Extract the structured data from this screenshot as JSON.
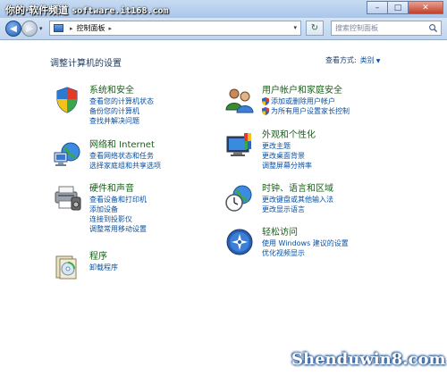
{
  "watermark_top": {
    "chinese": "你的·软件频道",
    "url": "software.it168.com"
  },
  "window_buttons": {
    "minimize": "–",
    "maximize": "□",
    "close": "✕"
  },
  "address": {
    "breadcrumb_sep": "▸",
    "path": "控制面板",
    "path_sep": "▸",
    "dropdown": "▾"
  },
  "nav": {
    "back": "◀",
    "forward": "▶",
    "recent": "▾",
    "refresh": "↻"
  },
  "search": {
    "placeholder": "搜索控制面板"
  },
  "main": {
    "title": "调整计算机的设置",
    "view_by_label": "查看方式:",
    "view_by_value": "类别",
    "view_by_caret": "▼"
  },
  "categories_left": [
    {
      "icon": "system-security-icon",
      "title": "系统和安全",
      "links": [
        "查看您的计算机状态",
        "备份您的计算机",
        "查找并解决问题"
      ]
    },
    {
      "icon": "network-internet-icon",
      "title": "网络和 Internet",
      "links": [
        "查看网络状态和任务",
        "选择家庭组和共享选项"
      ]
    },
    {
      "icon": "hardware-sound-icon",
      "title": "硬件和声音",
      "links": [
        "查看设备和打印机",
        "添加设备",
        "连接到投影仪",
        "调整常用移动设置"
      ]
    },
    {
      "icon": "programs-icon",
      "title": "程序",
      "links": [
        "卸载程序"
      ]
    }
  ],
  "categories_right": [
    {
      "icon": "user-accounts-icon",
      "title": "用户帐户和家庭安全",
      "links": [
        "添加或删除用户帐户",
        "为所有用户设置家长控制"
      ]
    },
    {
      "icon": "appearance-icon",
      "title": "外观和个性化",
      "links": [
        "更改主题",
        "更改桌面背景",
        "调整屏幕分辨率"
      ]
    },
    {
      "icon": "clock-language-icon",
      "title": "时钟、语言和区域",
      "links": [
        "更改键盘或其他输入法",
        "更改显示语言"
      ]
    },
    {
      "icon": "ease-of-access-icon",
      "title": "轻松访问",
      "links": [
        "使用 Windows 建议的设置",
        "优化视频显示"
      ]
    }
  ],
  "watermark_bottom": "Shenduwin8.com",
  "colors": {
    "title_green": "#1a5e1a",
    "link_blue": "#0a50a1",
    "frame": "#6d8cb4"
  }
}
